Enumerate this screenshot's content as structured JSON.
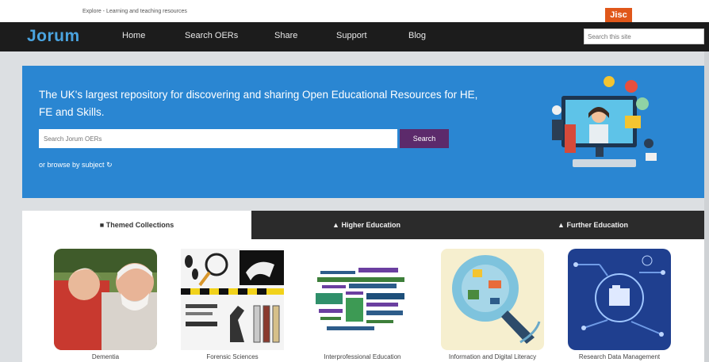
{
  "top": {
    "tagline": "Explore - Learning and teaching resources",
    "brand": "Jisc"
  },
  "nav": {
    "logo": "Jorum",
    "items": [
      "Home",
      "Search OERs",
      "Share",
      "Support",
      "Blog"
    ],
    "search_placeholder": "Search this site"
  },
  "hero": {
    "heading": "The UK's largest repository for discovering and sharing Open Educational Resources for HE, FE and Skills.",
    "search_placeholder": "Search Jorum OERs",
    "search_button": "Search",
    "browse_link": "or browse by subject"
  },
  "tabs": [
    "Themed Collections",
    "Higher Education",
    "Further Education"
  ],
  "collections": [
    {
      "label": "Dementia",
      "image": "elderly-couple-photo"
    },
    {
      "label": "Forensic Sciences",
      "image": "forensic-tools-photo"
    },
    {
      "label": "Interprofessional Education",
      "image": "word-cloud"
    },
    {
      "label": "Information and Digital Literacy",
      "image": "digital-literacy-illustration"
    },
    {
      "label": "Research Data Management",
      "image": "data-circuit-illustration"
    }
  ],
  "colors": {
    "nav_bg": "#1c1c1c",
    "logo": "#4aa3df",
    "hero_bg": "#2a86d2",
    "search_button": "#5c2a6b",
    "brand_badge": "#e0571a"
  }
}
